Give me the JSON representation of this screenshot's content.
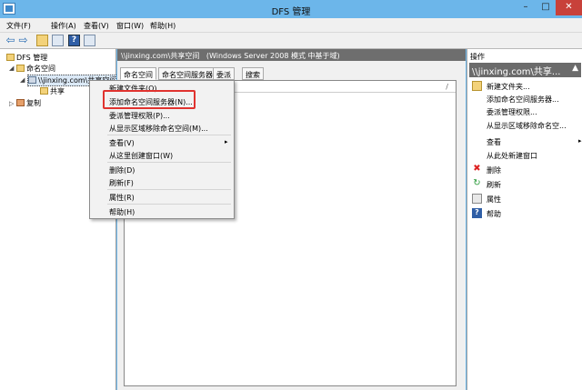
{
  "window": {
    "title": "DFS 管理",
    "minimize": "–",
    "maximize": "□",
    "close": "✕"
  },
  "menubar": [
    "文件(F)",
    "操作(A)",
    "查看(V)",
    "窗口(W)",
    "帮助(H)"
  ],
  "toolbar": {
    "back": "⇦",
    "forward": "⇨",
    "help": "?"
  },
  "tree": {
    "root": "DFS 管理",
    "namespaces": "命名空间",
    "namespace": "\\\\jinxing.com\\共享空间",
    "share": "共享",
    "replication": "复制"
  },
  "center": {
    "header_path": "\\\\jinxing.com\\共享空间",
    "header_info": "(Windows Server 2008 模式 中基于域)",
    "tabs": [
      "命名空间",
      "命名空间服务器",
      "委派",
      "搜索"
    ],
    "col_sep": "/"
  },
  "context_menu": {
    "items": [
      "新建文件夹(O)...",
      "添加命名空间服务器(N)...",
      "委派管理权限(P)...",
      "从显示区域移除命名空间(M)...",
      "查看(V)",
      "从这里创建窗口(W)",
      "删除(D)",
      "刷新(F)",
      "属性(R)",
      "帮助(H)"
    ],
    "submenu_arrow": "▸"
  },
  "actions": {
    "title": "操作",
    "group": "\\\\jinxing.com\\共享...",
    "group_caret": "▲",
    "items": [
      "新建文件夹...",
      "添加命名空间服务器...",
      "委派管理权限...",
      "从显示区域移除命名空...",
      "查看",
      "从此处新建窗口",
      "删除",
      "刷新",
      "属性",
      "帮助"
    ],
    "submenu_arrow": "▸"
  }
}
